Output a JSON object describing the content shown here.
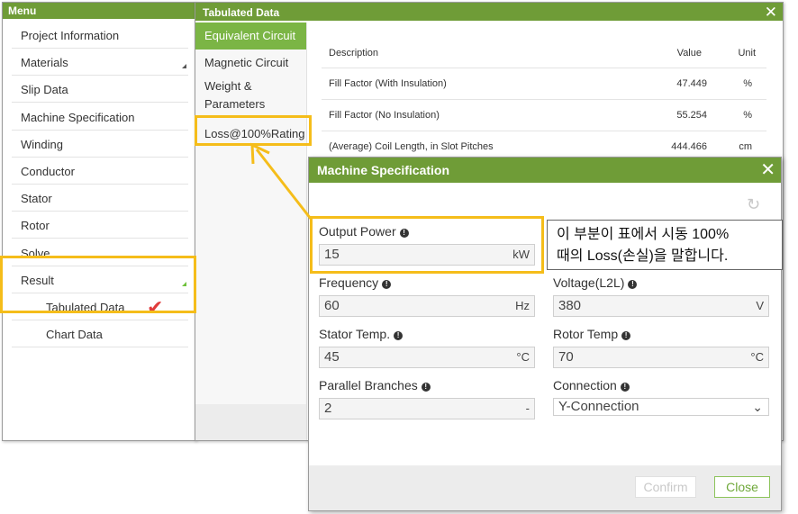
{
  "menu": {
    "title": "Menu",
    "items": [
      {
        "label": "Project Information"
      },
      {
        "label": "Materials"
      },
      {
        "label": "Slip Data"
      },
      {
        "label": "Machine Specification"
      },
      {
        "label": "Winding"
      },
      {
        "label": "Conductor"
      },
      {
        "label": "Stator"
      },
      {
        "label": "Rotor"
      },
      {
        "label": "Solve"
      },
      {
        "label": "Result"
      },
      {
        "label": "Tabulated Data"
      },
      {
        "label": "Chart Data"
      }
    ]
  },
  "tabulated": {
    "title": "Tabulated Data",
    "close_icon": "close-icon",
    "tabs": [
      {
        "label": "Equivalent Circuit",
        "active": true
      },
      {
        "label": "Magnetic Circuit"
      },
      {
        "label": "Weight &"
      },
      {
        "label": "Parameters"
      },
      {
        "label": "Loss@100%Rating"
      }
    ],
    "table": {
      "headers": [
        "Description",
        "Value",
        "Unit"
      ],
      "rows": [
        [
          "Fill Factor (With Insulation)",
          "47.449",
          "%"
        ],
        [
          "Fill Factor (No Insulation)",
          "55.254",
          "%"
        ],
        [
          "(Average) Coil Length, in Slot Pitches",
          "444.466",
          "cm"
        ]
      ]
    }
  },
  "dialog": {
    "title": "Machine Specification",
    "refresh_icon": "refresh-icon",
    "fields": {
      "output_power": {
        "label": "Output Power",
        "value": "15",
        "unit": "kW"
      },
      "frequency": {
        "label": "Frequency",
        "value": "60",
        "unit": "Hz"
      },
      "voltage": {
        "label": "Voltage(L2L)",
        "value": "380",
        "unit": "V"
      },
      "stator_temp": {
        "label": "Stator Temp.",
        "value": "45",
        "unit": "°C"
      },
      "rotor_temp": {
        "label": "Rotor Temp",
        "value": "70",
        "unit": "°C"
      },
      "parallel_branches": {
        "label": "Parallel Branches",
        "value": "2",
        "unit": "-"
      },
      "connection": {
        "label": "Connection",
        "value": "Y-Connection"
      }
    },
    "confirm_label": "Confirm",
    "close_label": "Close"
  },
  "annotation": {
    "line1": "이 부분이 표에서 시동 100%",
    "line2": "때의 Loss(손실)을 말합니다.",
    "highlight_color": "#f5bd1a",
    "check_color": "#e03c3c"
  },
  "colors": {
    "header": "#6f9c37",
    "active_tab": "#7bb545"
  }
}
